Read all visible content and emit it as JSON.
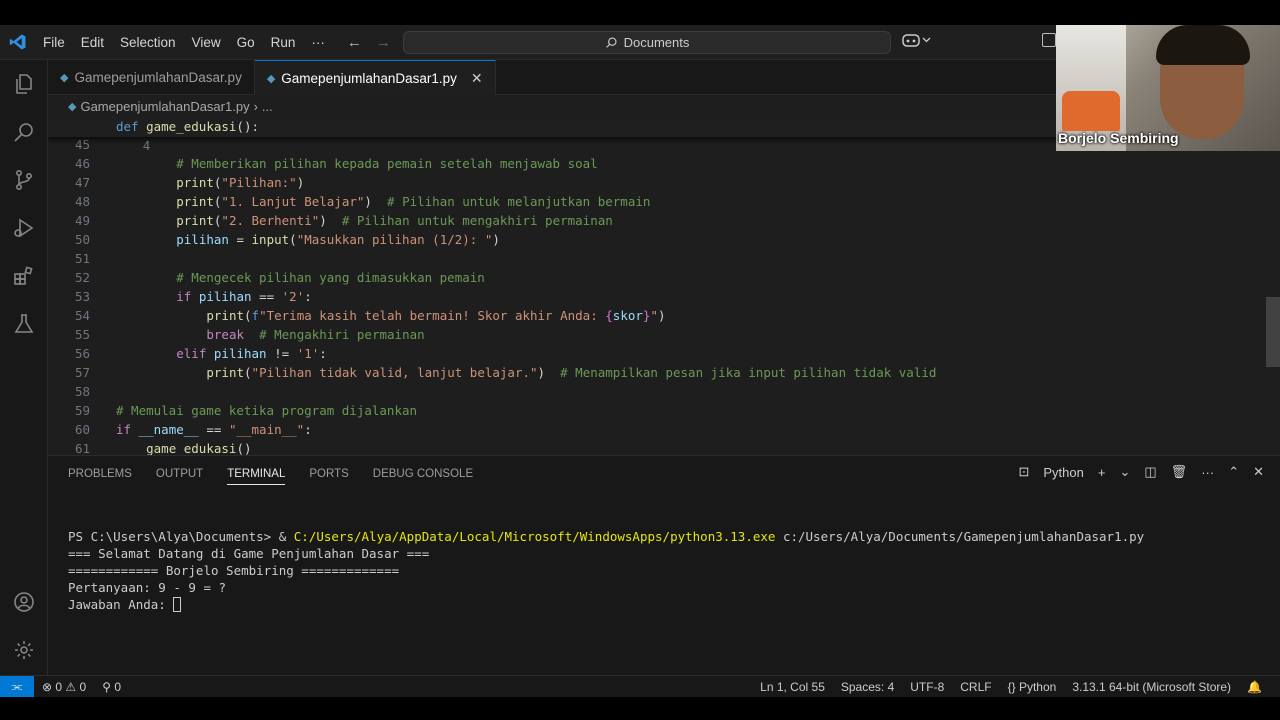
{
  "menu": {
    "items": [
      "File",
      "Edit",
      "Selection",
      "View",
      "Go",
      "Run",
      "···"
    ],
    "search_label": "Documents"
  },
  "tabs": [
    {
      "label": "GamepenjumlahanDasar.py",
      "active": false
    },
    {
      "label": "GamepenjumlahanDasar1.py",
      "active": true
    }
  ],
  "breadcrumb": {
    "file": "GamepenjumlahanDasar1.py",
    "rest": "..."
  },
  "editor": {
    "sticky": {
      "num": "4",
      "text": "def game_edukasi():"
    },
    "lines": [
      {
        "num": "45",
        "text": ""
      },
      {
        "num": "46",
        "text": "        # Memberikan pilihan kepada pemain setelah menjawab soal"
      },
      {
        "num": "47",
        "text": "        print(\"Pilihan:\")"
      },
      {
        "num": "48",
        "text": "        print(\"1. Lanjut Belajar\")  # Pilihan untuk melanjutkan bermain"
      },
      {
        "num": "49",
        "text": "        print(\"2. Berhenti\")  # Pilihan untuk mengakhiri permainan"
      },
      {
        "num": "50",
        "text": "        pilihan = input(\"Masukkan pilihan (1/2): \")"
      },
      {
        "num": "51",
        "text": ""
      },
      {
        "num": "52",
        "text": "        # Mengecek pilihan yang dimasukkan pemain"
      },
      {
        "num": "53",
        "text": "        if pilihan == '2':"
      },
      {
        "num": "54",
        "text": "            print(f\"Terima kasih telah bermain! Skor akhir Anda: {skor}\")"
      },
      {
        "num": "55",
        "text": "            break  # Mengakhiri permainan"
      },
      {
        "num": "56",
        "text": "        elif pilihan != '1':"
      },
      {
        "num": "57",
        "text": "            print(\"Pilihan tidak valid, lanjut belajar.\")  # Menampilkan pesan jika input pilihan tidak valid"
      },
      {
        "num": "58",
        "text": ""
      },
      {
        "num": "59",
        "text": "# Memulai game ketika program dijalankan"
      },
      {
        "num": "60",
        "text": "if __name__ == \"__main__\":"
      },
      {
        "num": "61",
        "text": "    game_edukasi()"
      }
    ]
  },
  "panel": {
    "tabs": [
      "PROBLEMS",
      "OUTPUT",
      "TERMINAL",
      "PORTS",
      "DEBUG CONSOLE"
    ],
    "active_tab": "TERMINAL",
    "shell_label": "Python",
    "terminal": {
      "prompt": "PS C:\\Users\\Alya\\Documents> & ",
      "exe": "C:/Users/Alya/AppData/Local/Microsoft/WindowsApps/python3.13.exe",
      "script": " c:/Users/Alya/Documents/GamepenjumlahanDasar1.py",
      "out1": "=== Selamat Datang di Game Penjumlahan Dasar ===",
      "out2": "============ Borjelo Sembiring =============",
      "out3": "Pertanyaan: 9 - 9 = ?",
      "out4": "Jawaban Anda: "
    }
  },
  "status": {
    "errors": "0",
    "warnings": "0",
    "ports": "0",
    "position": "Ln 1, Col 55",
    "spaces": "Spaces: 4",
    "encoding": "UTF-8",
    "eol": "CRLF",
    "language": "Python",
    "interpreter": "3.13.1 64-bit (Microsoft Store)"
  },
  "webcam": {
    "name": "Borjelo Sembiring"
  },
  "colors": {
    "accent": "#0078d4",
    "editor_bg": "#1e1e1e",
    "terminal_exe": "#e5e510"
  }
}
